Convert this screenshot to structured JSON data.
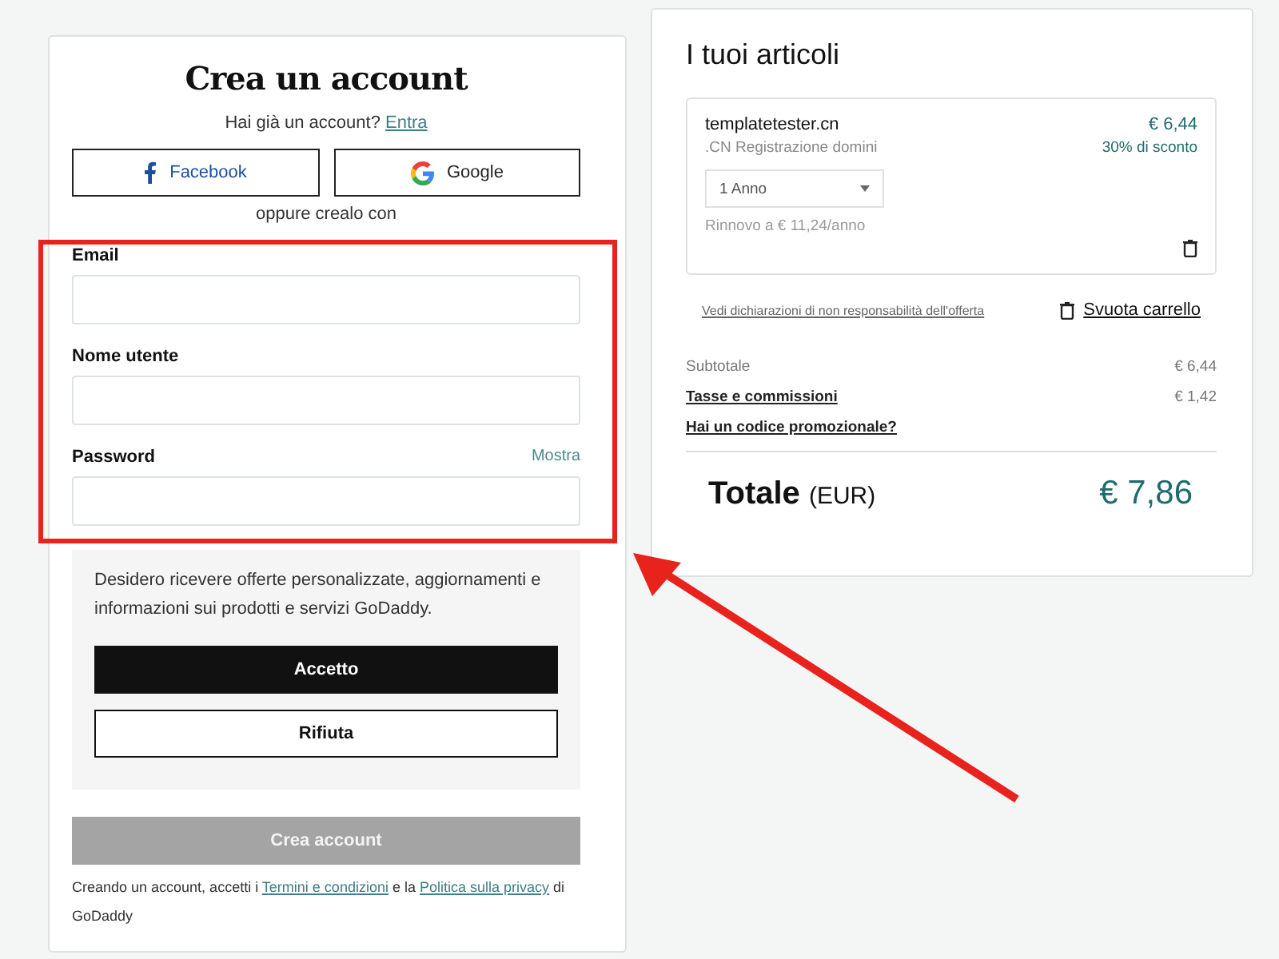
{
  "signup": {
    "title": "Crea un account",
    "have_account": "Hai già un account?",
    "login_link": "Entra",
    "social_buttons": [
      {
        "kind": "facebook",
        "label": "Facebook"
      },
      {
        "kind": "google",
        "label": "Google"
      }
    ],
    "divider_text": "oppure crealo con",
    "fields": [
      {
        "label": "Email"
      },
      {
        "label": "Nome utente"
      },
      {
        "label": "Password",
        "action": "Mostra"
      }
    ],
    "consent": {
      "text": "Desidero ricevere offerte personalizzate, aggiornamenti e informazioni sui prodotti e servizi GoDaddy.",
      "accept": "Accetto",
      "decline": "Rifiuta"
    },
    "submit": {
      "label": "Crea account",
      "disabled": true
    },
    "legal": {
      "before": "Creando un account, accetti i",
      "terms": "Termini e condizioni",
      "middle": "e la",
      "privacy": "Politica sulla privacy",
      "after": "di GoDaddy"
    }
  },
  "cart": {
    "title": "I tuoi articoli",
    "item": {
      "name": "templatetester.cn",
      "description": ".CN Registrazione domini",
      "price": "€ 6,44",
      "discount": "30% di sconto",
      "term": "1 Anno",
      "renewal": "Rinnovo a € 11,24/anno"
    },
    "disclaimer_link": "Vedi dichiarazioni di non responsabilità dell'offerta",
    "empty_cart": "Svuota carrello",
    "summary": [
      {
        "label": "Subtotale",
        "value": "€ 6,44",
        "link": false
      },
      {
        "label": "Tasse e commissioni",
        "value": "€ 1,42",
        "link": true
      }
    ],
    "promo_link": "Hai un codice promozionale?",
    "total_label": "Totale",
    "currency": "(EUR)",
    "total": "€ 7,86"
  }
}
